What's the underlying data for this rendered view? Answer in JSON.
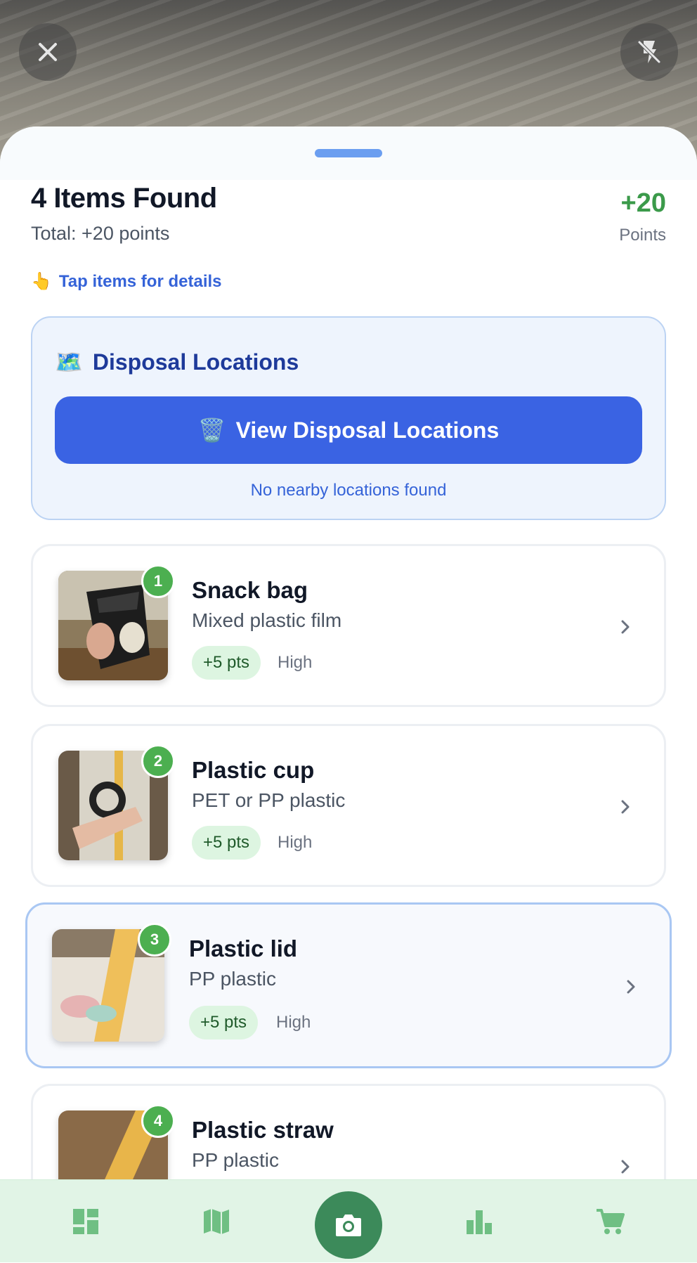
{
  "camera": {
    "close_icon": "close-icon",
    "flash_icon": "flash-off-icon"
  },
  "header": {
    "title": "4 Items Found",
    "subtitle": "Total: +20 points",
    "points_value": "+20",
    "points_label": "Points",
    "tap_hint_emoji": "👆",
    "tap_hint": "Tap items for details"
  },
  "disposal": {
    "emoji": "🗺️",
    "title": "Disposal Locations",
    "button_emoji": "🗑️",
    "button_label": "View Disposal Locations",
    "note": "No nearby locations found"
  },
  "items": [
    {
      "index": "1",
      "name": "Snack bag",
      "material": "Mixed plastic film",
      "points": "+5 pts",
      "confidence": "High"
    },
    {
      "index": "2",
      "name": "Plastic cup",
      "material": "PET or PP plastic",
      "points": "+5 pts",
      "confidence": "High"
    },
    {
      "index": "3",
      "name": "Plastic lid",
      "material": "PP plastic",
      "points": "+5 pts",
      "confidence": "High"
    },
    {
      "index": "4",
      "name": "Plastic straw",
      "material": "PP plastic",
      "points": "",
      "confidence": ""
    }
  ],
  "nav": {
    "items": [
      "dashboard-icon",
      "map-icon",
      "camera-icon",
      "leaderboard-icon",
      "cart-icon"
    ],
    "colors": {
      "inactive": "#6fbf83",
      "active_bg": "#3c8a5a",
      "bar_bg": "#e1f4e6"
    }
  },
  "colors": {
    "accent_blue": "#3a63e3",
    "points_green": "#3b9a4a",
    "badge_green": "#4caf50"
  }
}
